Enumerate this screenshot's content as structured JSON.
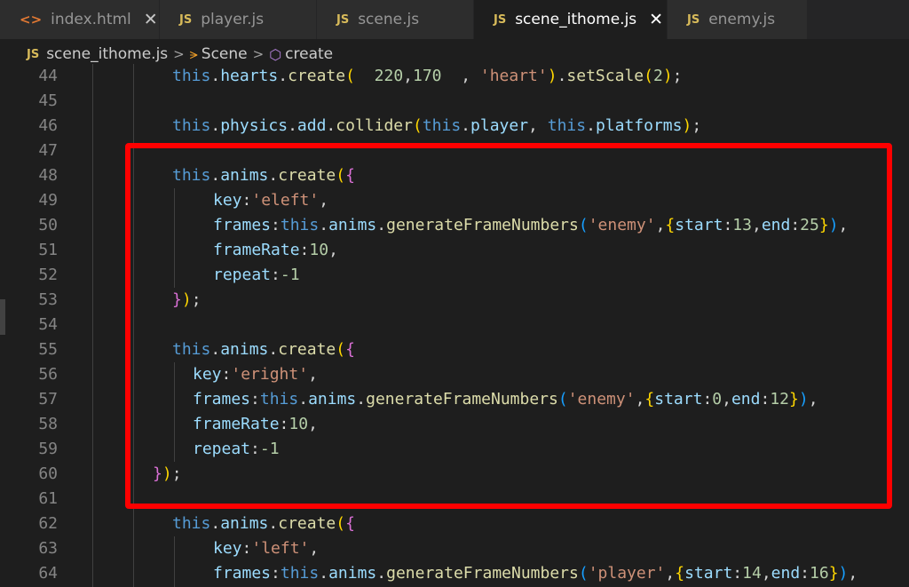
{
  "tabs": [
    {
      "icon": "<>",
      "kind": "html",
      "label": "index.html",
      "close": "✕",
      "active": false
    },
    {
      "icon": "JS",
      "kind": "js",
      "label": "player.js",
      "close": "",
      "active": false
    },
    {
      "icon": "JS",
      "kind": "js",
      "label": "scene.js",
      "close": "",
      "active": false
    },
    {
      "icon": "JS",
      "kind": "js",
      "label": "scene_ithome.js",
      "close": "✕",
      "active": true
    },
    {
      "icon": "JS",
      "kind": "js",
      "label": "enemy.js",
      "close": "",
      "active": false
    }
  ],
  "breadcrumb": {
    "file_icon": "JS",
    "file": "scene_ithome.js",
    "sep": ">",
    "class_name": "Scene",
    "method": "create"
  },
  "code_lines": [
    {
      "n": "44",
      "indent": 1,
      "tokens": [
        [
          "this",
          "t-this"
        ],
        [
          ".",
          "t-punc"
        ],
        [
          "hearts",
          "t-prop"
        ],
        [
          ".",
          "t-punc"
        ],
        [
          "create",
          "t-fn"
        ],
        [
          "(",
          "t-p1"
        ],
        [
          "  ",
          "t-punc"
        ],
        [
          "220",
          "t-num"
        ],
        [
          ",",
          "t-punc"
        ],
        [
          "170",
          "t-num"
        ],
        [
          "  , ",
          "t-punc"
        ],
        [
          "'heart'",
          "t-str"
        ],
        [
          ")",
          "t-p1"
        ],
        [
          ".",
          "t-punc"
        ],
        [
          "setScale",
          "t-fn"
        ],
        [
          "(",
          "t-p1"
        ],
        [
          "2",
          "t-num"
        ],
        [
          ")",
          "t-p1"
        ],
        [
          ";",
          "t-punc"
        ]
      ]
    },
    {
      "n": "45",
      "indent": 0,
      "tokens": []
    },
    {
      "n": "46",
      "indent": 1,
      "tokens": [
        [
          "this",
          "t-this"
        ],
        [
          ".",
          "t-punc"
        ],
        [
          "physics",
          "t-prop"
        ],
        [
          ".",
          "t-punc"
        ],
        [
          "add",
          "t-prop"
        ],
        [
          ".",
          "t-punc"
        ],
        [
          "collider",
          "t-fn"
        ],
        [
          "(",
          "t-p1"
        ],
        [
          "this",
          "t-this"
        ],
        [
          ".",
          "t-punc"
        ],
        [
          "player",
          "t-prop"
        ],
        [
          ", ",
          "t-punc"
        ],
        [
          "this",
          "t-this"
        ],
        [
          ".",
          "t-punc"
        ],
        [
          "platforms",
          "t-prop"
        ],
        [
          ")",
          "t-p1"
        ],
        [
          ";",
          "t-punc"
        ]
      ]
    },
    {
      "n": "47",
      "indent": 0,
      "tokens": []
    },
    {
      "n": "48",
      "indent": 1,
      "tokens": [
        [
          "this",
          "t-this"
        ],
        [
          ".",
          "t-punc"
        ],
        [
          "anims",
          "t-prop"
        ],
        [
          ".",
          "t-punc"
        ],
        [
          "create",
          "t-fn"
        ],
        [
          "(",
          "t-p1"
        ],
        [
          "{",
          "t-p2"
        ]
      ]
    },
    {
      "n": "49",
      "indent": 2,
      "tokens": [
        [
          "key",
          "t-prop"
        ],
        [
          ":",
          "t-punc"
        ],
        [
          "'eleft'",
          "t-str"
        ],
        [
          ",",
          "t-punc"
        ]
      ]
    },
    {
      "n": "50",
      "indent": 2,
      "tokens": [
        [
          "frames",
          "t-prop"
        ],
        [
          ":",
          "t-punc"
        ],
        [
          "this",
          "t-this"
        ],
        [
          ".",
          "t-punc"
        ],
        [
          "anims",
          "t-prop"
        ],
        [
          ".",
          "t-punc"
        ],
        [
          "generateFrameNumbers",
          "t-fn"
        ],
        [
          "(",
          "t-p3"
        ],
        [
          "'enemy'",
          "t-str"
        ],
        [
          ",",
          "t-punc"
        ],
        [
          "{",
          "t-p1"
        ],
        [
          "start",
          "t-prop"
        ],
        [
          ":",
          "t-punc"
        ],
        [
          "13",
          "t-num"
        ],
        [
          ",",
          "t-punc"
        ],
        [
          "end",
          "t-prop"
        ],
        [
          ":",
          "t-punc"
        ],
        [
          "25",
          "t-num"
        ],
        [
          "}",
          "t-p1"
        ],
        [
          ")",
          "t-p3"
        ],
        [
          ",",
          "t-punc"
        ]
      ]
    },
    {
      "n": "51",
      "indent": 2,
      "tokens": [
        [
          "frameRate",
          "t-prop"
        ],
        [
          ":",
          "t-punc"
        ],
        [
          "10",
          "t-num"
        ],
        [
          ",",
          "t-punc"
        ]
      ]
    },
    {
      "n": "52",
      "indent": 2,
      "tokens": [
        [
          "repeat",
          "t-prop"
        ],
        [
          ":",
          "t-punc"
        ],
        [
          "-1",
          "t-num"
        ]
      ]
    },
    {
      "n": "53",
      "indent": 1,
      "tokens": [
        [
          "}",
          "t-p2"
        ],
        [
          ")",
          "t-p1"
        ],
        [
          ";",
          "t-punc"
        ]
      ]
    },
    {
      "n": "54",
      "indent": 0,
      "tokens": []
    },
    {
      "n": "55",
      "indent": 1,
      "tokens": [
        [
          "this",
          "t-this"
        ],
        [
          ".",
          "t-punc"
        ],
        [
          "anims",
          "t-prop"
        ],
        [
          ".",
          "t-punc"
        ],
        [
          "create",
          "t-fn"
        ],
        [
          "(",
          "t-p1"
        ],
        [
          "{",
          "t-p2"
        ]
      ]
    },
    {
      "n": "56",
      "indent": 1.5,
      "tokens": [
        [
          "key",
          "t-prop"
        ],
        [
          ":",
          "t-punc"
        ],
        [
          "'eright'",
          "t-str"
        ],
        [
          ",",
          "t-punc"
        ]
      ]
    },
    {
      "n": "57",
      "indent": 1.5,
      "tokens": [
        [
          "frames",
          "t-prop"
        ],
        [
          ":",
          "t-punc"
        ],
        [
          "this",
          "t-this"
        ],
        [
          ".",
          "t-punc"
        ],
        [
          "anims",
          "t-prop"
        ],
        [
          ".",
          "t-punc"
        ],
        [
          "generateFrameNumbers",
          "t-fn"
        ],
        [
          "(",
          "t-p3"
        ],
        [
          "'enemy'",
          "t-str"
        ],
        [
          ",",
          "t-punc"
        ],
        [
          "{",
          "t-p1"
        ],
        [
          "start",
          "t-prop"
        ],
        [
          ":",
          "t-punc"
        ],
        [
          "0",
          "t-num"
        ],
        [
          ",",
          "t-punc"
        ],
        [
          "end",
          "t-prop"
        ],
        [
          ":",
          "t-punc"
        ],
        [
          "12",
          "t-num"
        ],
        [
          "}",
          "t-p1"
        ],
        [
          ")",
          "t-p3"
        ],
        [
          ",",
          "t-punc"
        ]
      ]
    },
    {
      "n": "58",
      "indent": 1.5,
      "tokens": [
        [
          "frameRate",
          "t-prop"
        ],
        [
          ":",
          "t-punc"
        ],
        [
          "10",
          "t-num"
        ],
        [
          ",",
          "t-punc"
        ]
      ]
    },
    {
      "n": "59",
      "indent": 1.5,
      "tokens": [
        [
          "repeat",
          "t-prop"
        ],
        [
          ":",
          "t-punc"
        ],
        [
          "-1",
          "t-num"
        ]
      ]
    },
    {
      "n": "60",
      "indent": 0.9,
      "tokens": [
        [
          "}",
          "t-p2"
        ],
        [
          ")",
          "t-p1"
        ],
        [
          ";",
          "t-punc"
        ]
      ]
    },
    {
      "n": "61",
      "indent": 0,
      "tokens": []
    },
    {
      "n": "62",
      "indent": 1,
      "tokens": [
        [
          "this",
          "t-this"
        ],
        [
          ".",
          "t-punc"
        ],
        [
          "anims",
          "t-prop"
        ],
        [
          ".",
          "t-punc"
        ],
        [
          "create",
          "t-fn"
        ],
        [
          "(",
          "t-p1"
        ],
        [
          "{",
          "t-p2"
        ]
      ]
    },
    {
      "n": "63",
      "indent": 2,
      "tokens": [
        [
          "key",
          "t-prop"
        ],
        [
          ":",
          "t-punc"
        ],
        [
          "'left'",
          "t-str"
        ],
        [
          ",",
          "t-punc"
        ]
      ]
    },
    {
      "n": "64",
      "indent": 2,
      "tokens": [
        [
          "frames",
          "t-prop"
        ],
        [
          ":",
          "t-punc"
        ],
        [
          "this",
          "t-this"
        ],
        [
          ".",
          "t-punc"
        ],
        [
          "anims",
          "t-prop"
        ],
        [
          ".",
          "t-punc"
        ],
        [
          "generateFrameNumbers",
          "t-fn"
        ],
        [
          "(",
          "t-p3"
        ],
        [
          "'player'",
          "t-str"
        ],
        [
          ",",
          "t-punc"
        ],
        [
          "{",
          "t-p1"
        ],
        [
          "start",
          "t-prop"
        ],
        [
          ":",
          "t-punc"
        ],
        [
          "14",
          "t-num"
        ],
        [
          ",",
          "t-punc"
        ],
        [
          "end",
          "t-prop"
        ],
        [
          ":",
          "t-punc"
        ],
        [
          "16",
          "t-num"
        ],
        [
          "}",
          "t-p1"
        ],
        [
          ")",
          "t-p3"
        ],
        [
          ",",
          "t-punc"
        ]
      ]
    }
  ],
  "colors": {
    "editor_bg": "#1e1e1e",
    "highlight_box": "#ff0000",
    "keyword": "#569cd6",
    "property": "#9cdcfe",
    "function": "#dcdcaa",
    "string": "#ce9178",
    "number": "#b5cea8"
  }
}
